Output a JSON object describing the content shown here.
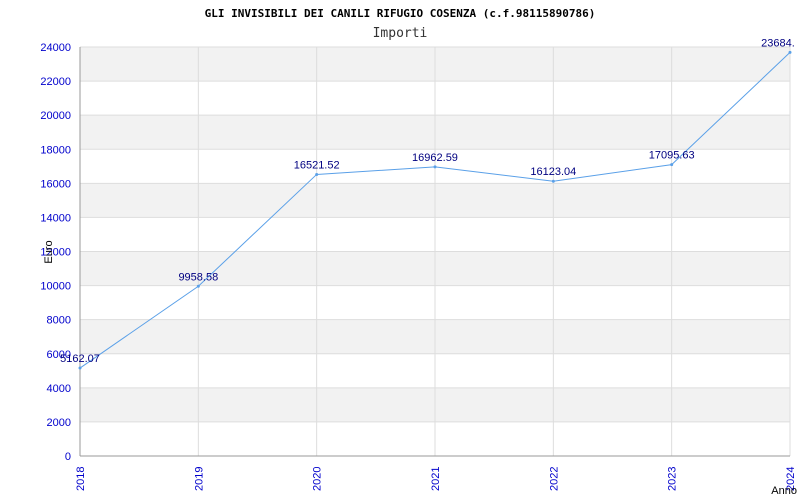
{
  "chart_data": {
    "type": "line",
    "title": "GLI INVISIBILI DEI CANILI RIFUGIO COSENZA (c.f.98115890786)",
    "subtitle": "Importi",
    "xlabel": "Anno",
    "ylabel": "Euro",
    "x": [
      "2018",
      "2019",
      "2020",
      "2021",
      "2022",
      "2023",
      "2024"
    ],
    "series": [
      {
        "name": "",
        "values": [
          5162.07,
          9958.58,
          16521.52,
          16962.59,
          16123.04,
          17095.63,
          23684.0
        ],
        "value_labels": [
          "5162.07",
          "9958.58",
          "16521.52",
          "16962.59",
          "16123.04",
          "17095.63",
          "23684."
        ]
      }
    ],
    "ylim": [
      0,
      24000
    ],
    "yticks": [
      0,
      2000,
      4000,
      6000,
      8000,
      10000,
      12000,
      14000,
      16000,
      18000,
      20000,
      22000,
      24000
    ],
    "grid": true,
    "colors": {
      "line": "#5aa0e8",
      "band_alt": "#f2f2f2",
      "grid": "#dddddd",
      "tick_label": "#0000cc",
      "data_label": "#000080"
    }
  }
}
